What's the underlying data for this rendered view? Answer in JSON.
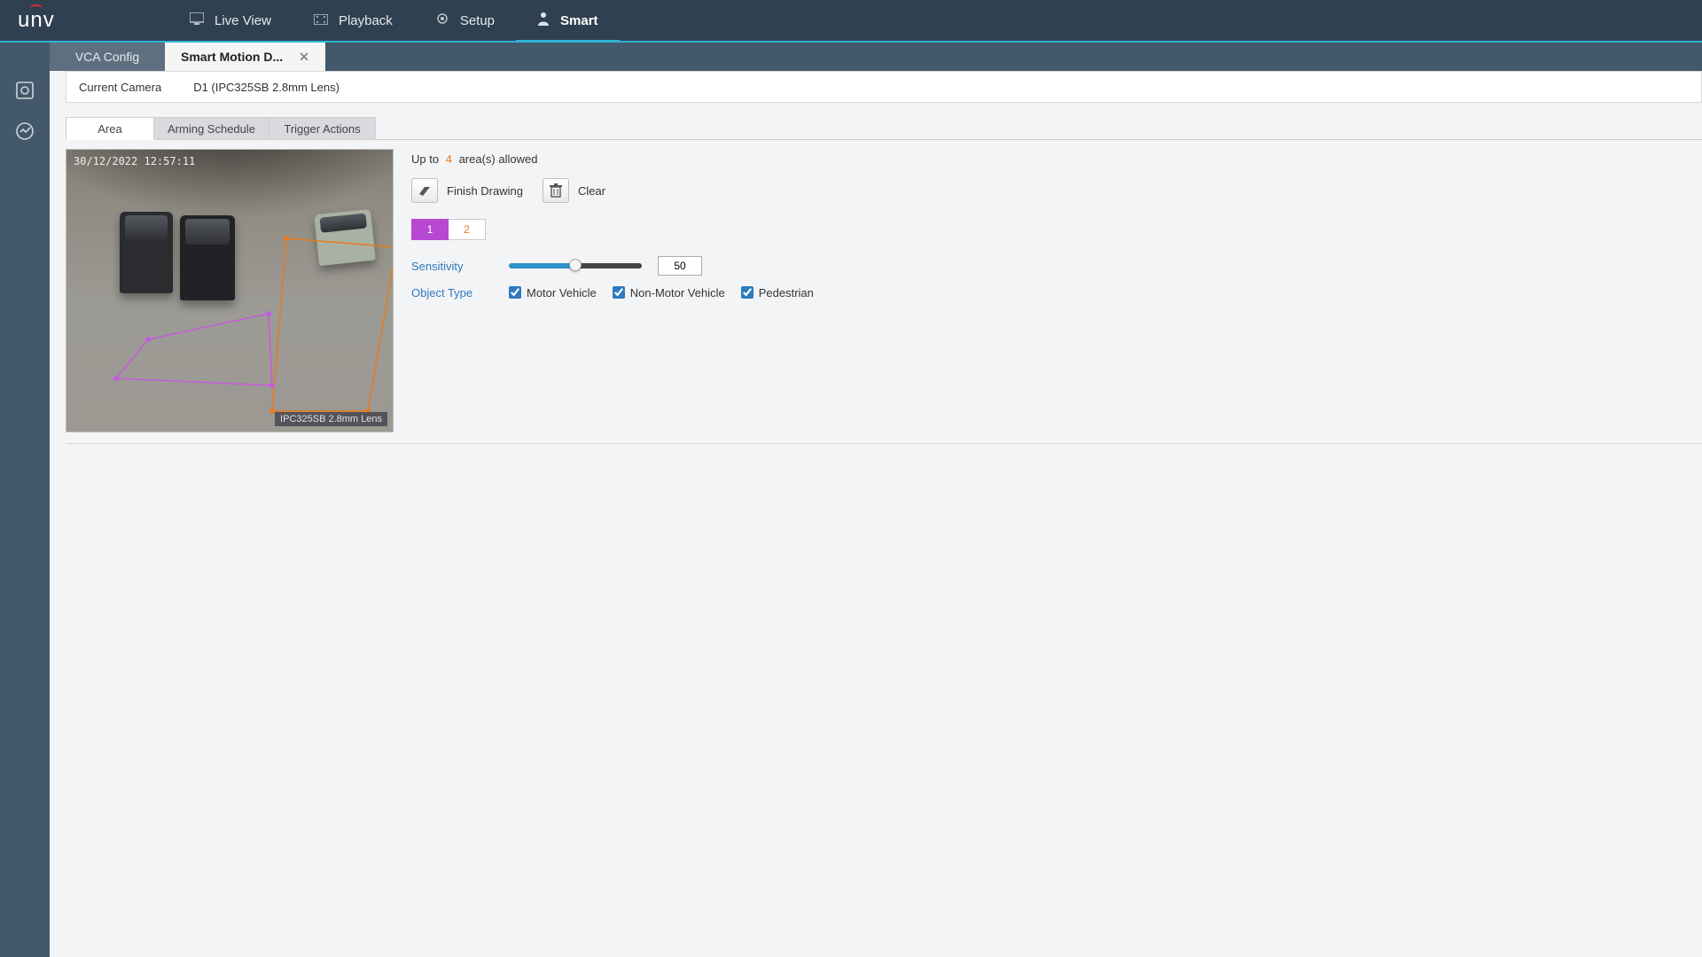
{
  "brand": "unv",
  "nav": {
    "items": [
      {
        "label": "Live View",
        "icon": "monitor-icon",
        "active": false
      },
      {
        "label": "Playback",
        "icon": "film-icon",
        "active": false
      },
      {
        "label": "Setup",
        "icon": "gear-icon",
        "active": false
      },
      {
        "label": "Smart",
        "icon": "person-icon",
        "active": true
      }
    ]
  },
  "tabs": [
    {
      "label": "VCA Config",
      "active": false,
      "closable": false
    },
    {
      "label": "Smart Motion D...",
      "active": true,
      "closable": true
    }
  ],
  "camera": {
    "label": "Current Camera",
    "value": "D1 (IPC325SB 2.8mm Lens)"
  },
  "subtabs": [
    {
      "label": "Area",
      "active": true
    },
    {
      "label": "Arming Schedule",
      "active": false
    },
    {
      "label": "Trigger Actions",
      "active": false
    }
  ],
  "preview": {
    "timestamp": "30/12/2022 12:57:11",
    "overlay_label": "IPC325SB 2.8mm Lens"
  },
  "area": {
    "allowed_prefix": "Up to",
    "allowed_count": "4",
    "allowed_suffix": "area(s) allowed",
    "finish_drawing": "Finish Drawing",
    "clear": "Clear",
    "tabs": [
      {
        "label": "1",
        "active": true
      },
      {
        "label": "2",
        "active": false
      }
    ]
  },
  "sensitivity": {
    "label": "Sensitivity",
    "value": "50"
  },
  "object_type": {
    "label": "Object Type",
    "options": [
      {
        "label": "Motor Vehicle",
        "checked": true
      },
      {
        "label": "Non-Motor Vehicle",
        "checked": true
      },
      {
        "label": "Pedestrian",
        "checked": true
      }
    ]
  }
}
